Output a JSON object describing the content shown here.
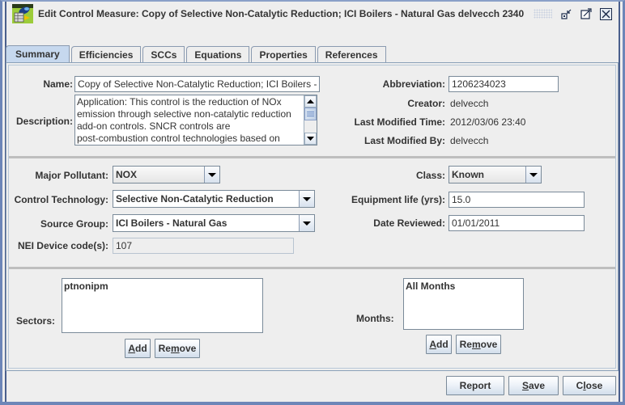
{
  "window": {
    "title": "Edit Control Measure: Copy of Selective Non-Catalytic Reduction; ICI Boilers - Natural Gas delvecch 2340",
    "app_icon": "emf-app-icon",
    "controls": [
      "iconify-icon",
      "maximize-icon",
      "close-icon"
    ]
  },
  "tabs": [
    {
      "label": "Summary",
      "active": true
    },
    {
      "label": "Efficiencies",
      "active": false
    },
    {
      "label": "SCCs",
      "active": false
    },
    {
      "label": "Equations",
      "active": false
    },
    {
      "label": "Properties",
      "active": false
    },
    {
      "label": "References",
      "active": false
    }
  ],
  "summary": {
    "name": {
      "label": "Name:",
      "value": "Copy of Selective Non-Catalytic Reduction; ICI Boilers - Natural Gas"
    },
    "description": {
      "label": "Description:",
      "lines": [
        "Application:  This control is the reduction of NOx",
        "emission through selective non-catalytic reduction",
        "add-on controls.  SNCR controls are",
        "post-combustion control technologies based on"
      ]
    },
    "abbreviation": {
      "label": "Abbreviation:",
      "value": "1206234023"
    },
    "creator": {
      "label": "Creator:",
      "value": "delvecch"
    },
    "last_modified_time": {
      "label": "Last Modified Time:",
      "value": "2012/03/06 23:40"
    },
    "last_modified_by": {
      "label": "Last Modified By:",
      "value": "delvecch"
    }
  },
  "classification": {
    "major_pollutant": {
      "label": "Major Pollutant:",
      "value": "NOX"
    },
    "control_technology": {
      "label": "Control Technology:",
      "value": "Selective Non-Catalytic Reduction"
    },
    "source_group": {
      "label": "Source Group:",
      "value": "ICI Boilers - Natural Gas"
    },
    "nei_device_codes": {
      "label": "NEI Device code(s):",
      "value": "107"
    },
    "class": {
      "label": "Class:",
      "value": "Known"
    },
    "equipment_life": {
      "label": "Equipment life (yrs):",
      "value": "15.0"
    },
    "date_reviewed": {
      "label": "Date Reviewed:",
      "value": "01/01/2011"
    }
  },
  "sectors": {
    "label": "Sectors:",
    "items": [
      "ptnonipm"
    ],
    "add_label_prefix": "",
    "add_mnemonic": "A",
    "add_label_rest": "dd",
    "remove_label_prefix": "Re",
    "remove_mnemonic": "m",
    "remove_label_rest": "ove"
  },
  "months": {
    "label": "Months:",
    "items": [
      "All Months"
    ],
    "add_label_prefix": "",
    "add_mnemonic": "A",
    "add_label_rest": "dd",
    "remove_label_prefix": "Re",
    "remove_mnemonic": "m",
    "remove_label_rest": "ove"
  },
  "footer": {
    "report_label": "Report",
    "save_prefix": "",
    "save_mnemonic": "S",
    "save_rest": "ave",
    "close_prefix": "C",
    "close_mnemonic": "l",
    "close_rest": "ose"
  }
}
